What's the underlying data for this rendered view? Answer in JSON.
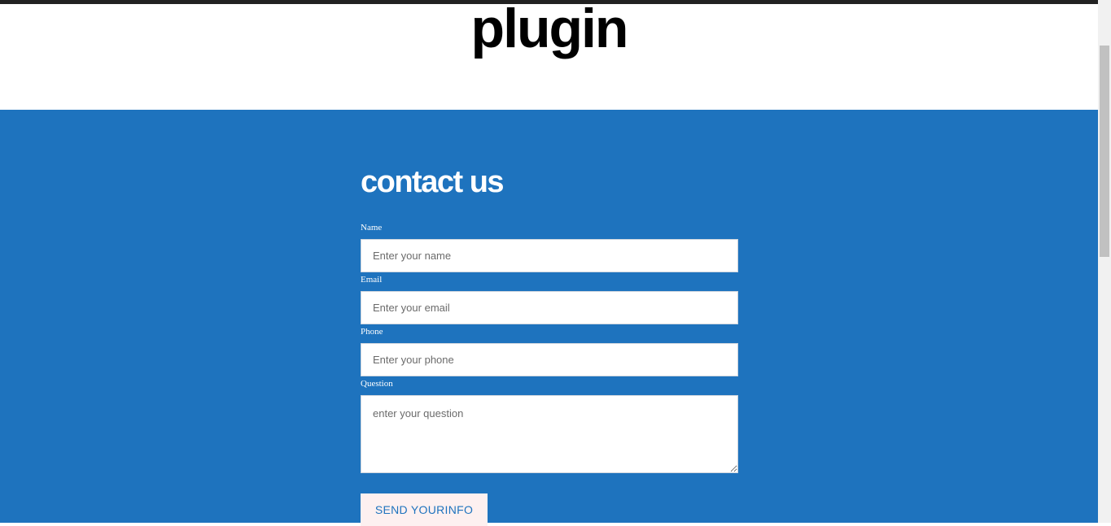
{
  "header": {
    "title": "plugin"
  },
  "contact": {
    "heading": "contact us",
    "fields": {
      "name": {
        "label": "Name",
        "placeholder": "Enter your name"
      },
      "email": {
        "label": "Email",
        "placeholder": "Enter your email"
      },
      "phone": {
        "label": "Phone",
        "placeholder": "Enter your phone"
      },
      "question": {
        "label": "Question",
        "placeholder": "enter your question"
      }
    },
    "submit_label": "SEND YOURINFO"
  },
  "colors": {
    "section_background": "#1e73be",
    "button_background": "#fdf0f0",
    "button_text": "#1e73be",
    "top_bar": "#222222"
  }
}
